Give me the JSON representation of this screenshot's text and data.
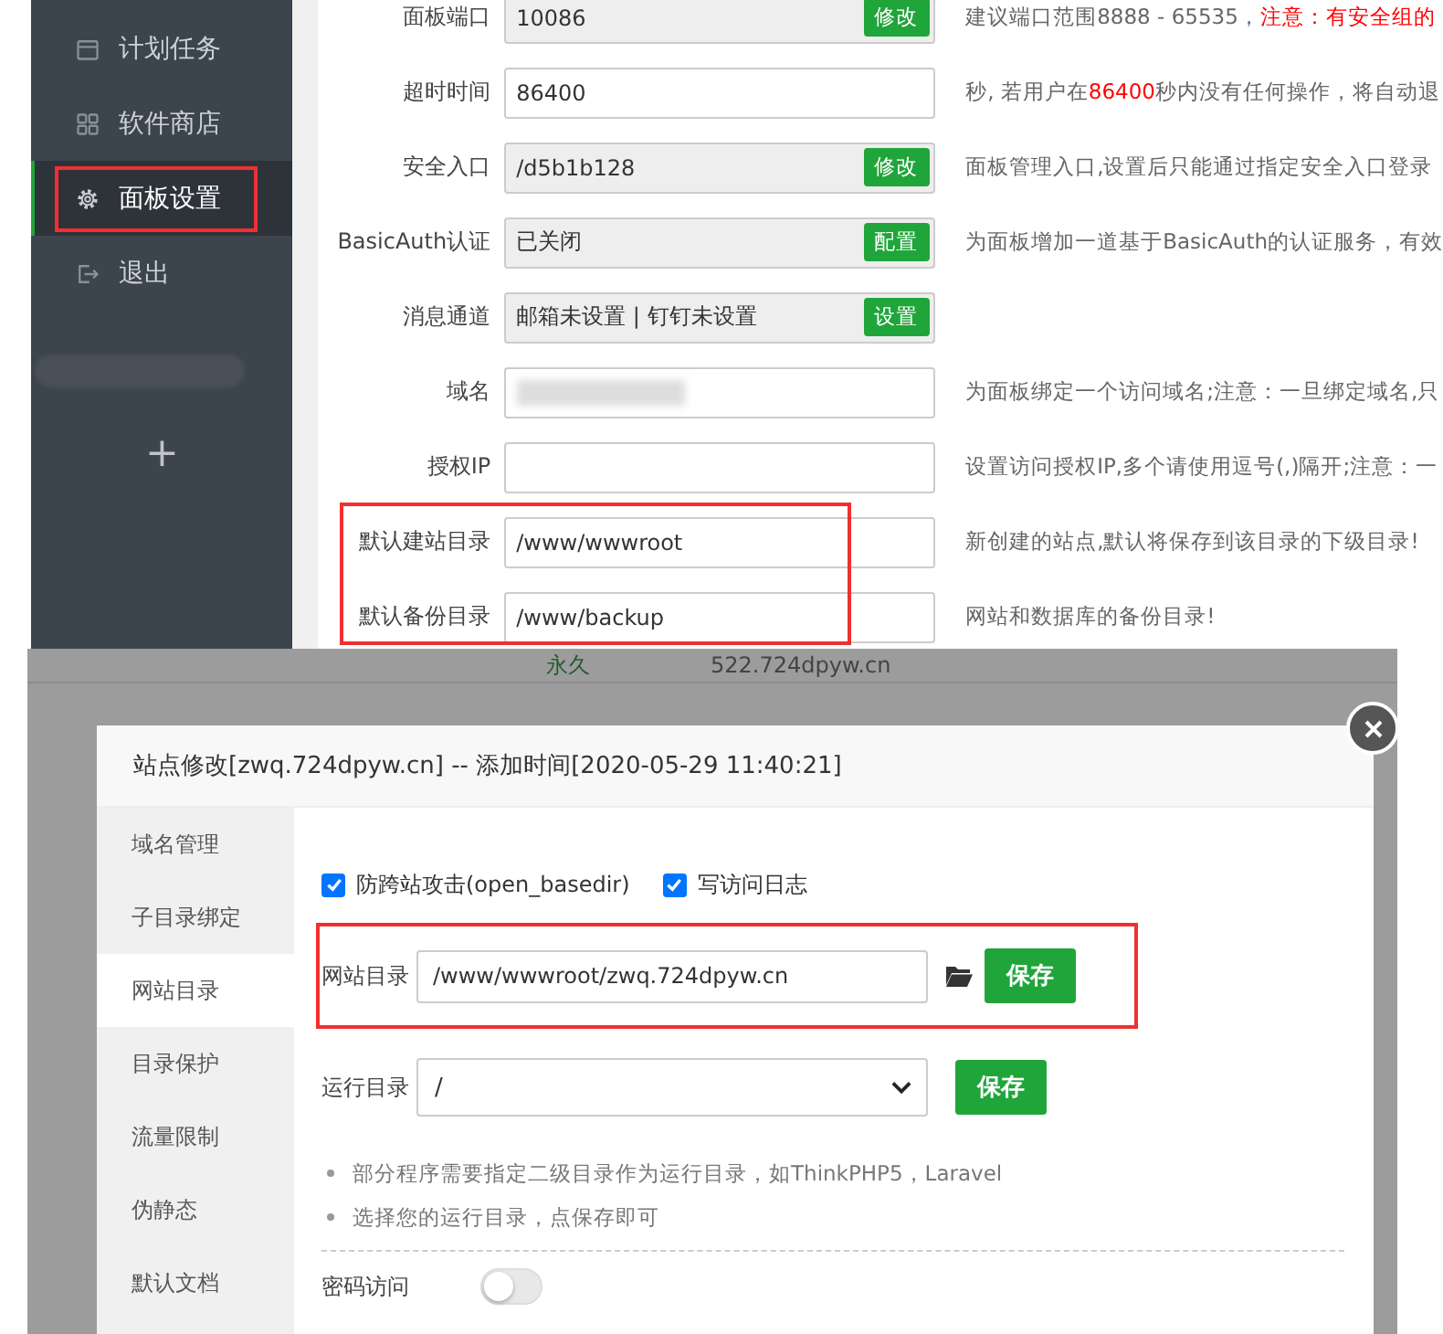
{
  "sidebar": {
    "items": [
      {
        "label": "计划任务",
        "selected": false,
        "highlighted": false
      },
      {
        "label": "软件商店",
        "selected": false,
        "highlighted": false
      },
      {
        "label": "面板设置",
        "selected": true,
        "highlighted": true
      },
      {
        "label": "退出",
        "selected": false,
        "highlighted": false
      }
    ],
    "add_label": "+"
  },
  "settings": {
    "groups": [
      {
        "highlighted": false,
        "rows": [
          {
            "label": "面板端口",
            "value": "10086",
            "readonly": true,
            "blurred": false,
            "button": "修改",
            "desc": [
              {
                "text": "建议端口范围8888 - 65535，",
                "warn": false
              },
              {
                "text": "注意：有安全组的",
                "warn": true
              }
            ]
          },
          {
            "label": "超时时间",
            "value": "86400",
            "readonly": false,
            "blurred": false,
            "desc": [
              {
                "text": "秒, 若用户在",
                "warn": false
              },
              {
                "text": "86400",
                "warn": true
              },
              {
                "text": "秒内没有任何操作，将自动退",
                "warn": false
              }
            ]
          },
          {
            "label": "安全入口",
            "value": "/d5b1b128",
            "readonly": true,
            "blurred": false,
            "button": "修改",
            "desc": [
              {
                "text": "面板管理入口,设置后只能通过指定安全入口登录",
                "warn": false
              }
            ]
          },
          {
            "label": "BasicAuth认证",
            "value": "已关闭",
            "readonly": true,
            "blurred": false,
            "button": "配置",
            "desc": [
              {
                "text": "为面板增加一道基于BasicAuth的认证服务，有效",
                "warn": false
              }
            ]
          },
          {
            "label": "消息通道",
            "value": "邮箱未设置 | 钉钉未设置",
            "readonly": true,
            "blurred": false,
            "button": "设置",
            "desc": []
          },
          {
            "label": "域名",
            "value": "",
            "readonly": false,
            "blurred": true,
            "desc": [
              {
                "text": "为面板绑定一个访问域名;注意：一旦绑定域名,只",
                "warn": false
              }
            ]
          },
          {
            "label": "授权IP",
            "value": "",
            "readonly": false,
            "blurred": false,
            "desc": [
              {
                "text": "设置访问授权IP,多个请使用逗号(,)隔开;注意：一",
                "warn": false
              }
            ]
          }
        ]
      },
      {
        "highlighted": true,
        "rows": [
          {
            "label": "默认建站目录",
            "value": "/www/wwwroot",
            "readonly": false,
            "blurred": false,
            "desc": [
              {
                "text": "新创建的站点,默认将保存到该目录的下级目录!",
                "warn": false
              }
            ]
          },
          {
            "label": "默认备份目录",
            "value": "/www/backup",
            "readonly": false,
            "blurred": false,
            "desc": [
              {
                "text": "网站和数据库的备份目录!",
                "warn": false
              }
            ]
          }
        ]
      }
    ]
  },
  "background_table": {
    "rows": [
      {
        "cells": [
          "永久",
          "522.724dpyw.cn"
        ]
      }
    ]
  },
  "dialog": {
    "title": "站点修改[zwq.724dpyw.cn] -- 添加时间[2020-05-29 11:40:21]",
    "tabs": [
      {
        "label": "域名管理",
        "selected": false
      },
      {
        "label": "子目录绑定",
        "selected": false
      },
      {
        "label": "网站目录",
        "selected": true
      },
      {
        "label": "目录保护",
        "selected": false
      },
      {
        "label": "流量限制",
        "selected": false
      },
      {
        "label": "伪静态",
        "selected": false
      },
      {
        "label": "默认文档",
        "selected": false
      }
    ],
    "options": [
      {
        "label": "防跨站攻击(open_basedir)",
        "checked": true
      },
      {
        "label": "写访问日志",
        "checked": true
      }
    ],
    "site_dir": {
      "label": "网站目录",
      "value": "/www/wwwroot/zwq.724dpyw.cn",
      "button": "保存",
      "highlighted": true
    },
    "run_dir": {
      "label": "运行目录",
      "value": "/",
      "button": "保存"
    },
    "tips": [
      "部分程序需要指定二级目录作为运行目录，如ThinkPHP5，Laravel",
      "选择您的运行目录，点保存即可"
    ],
    "password_access": {
      "label": "密码访问",
      "on": false
    }
  }
}
